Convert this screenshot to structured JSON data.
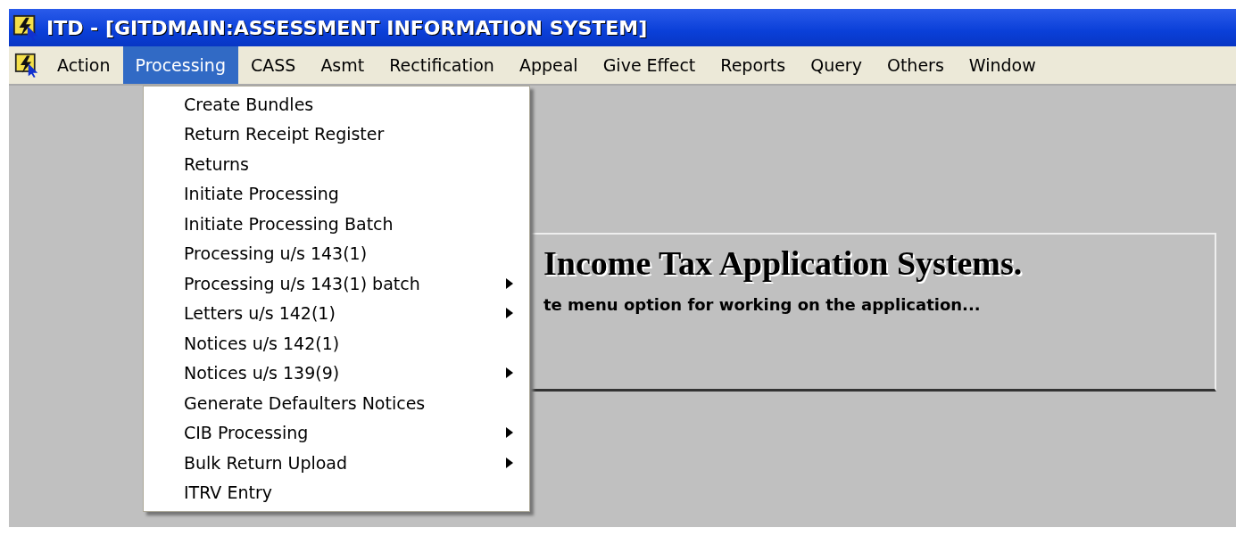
{
  "window": {
    "title": "ITD - [GITDMAIN:ASSESSMENT INFORMATION SYSTEM]"
  },
  "menubar": [
    {
      "label": "Action",
      "selected": false
    },
    {
      "label": "Processing",
      "selected": true
    },
    {
      "label": "CASS",
      "selected": false
    },
    {
      "label": "Asmt",
      "selected": false
    },
    {
      "label": "Rectification",
      "selected": false
    },
    {
      "label": "Appeal",
      "selected": false
    },
    {
      "label": "Give Effect",
      "selected": false
    },
    {
      "label": "Reports",
      "selected": false
    },
    {
      "label": "Query",
      "selected": false
    },
    {
      "label": "Others",
      "selected": false
    },
    {
      "label": "Window",
      "selected": false
    }
  ],
  "dropdown": [
    {
      "label": "Create Bundles",
      "submenu": false
    },
    {
      "label": "Return Receipt Register",
      "submenu": false
    },
    {
      "label": "Returns",
      "submenu": false
    },
    {
      "label": "Initiate Processing",
      "submenu": false
    },
    {
      "label": "Initiate Processing Batch",
      "submenu": false
    },
    {
      "label": "Processing u/s 143(1)",
      "submenu": false
    },
    {
      "label": "Processing u/s 143(1) batch",
      "submenu": true
    },
    {
      "label": "Letters u/s 142(1)",
      "submenu": true
    },
    {
      "label": "Notices u/s 142(1)",
      "submenu": false
    },
    {
      "label": "Notices u/s 139(9)",
      "submenu": true
    },
    {
      "label": "Generate Defaulters Notices",
      "submenu": false
    },
    {
      "label": "CIB Processing",
      "submenu": true
    },
    {
      "label": "Bulk Return Upload",
      "submenu": true
    },
    {
      "label": "ITRV Entry",
      "submenu": false
    }
  ],
  "welcome": {
    "heading": "Income Tax Application Systems.",
    "message": "te menu option for working on the application..."
  }
}
